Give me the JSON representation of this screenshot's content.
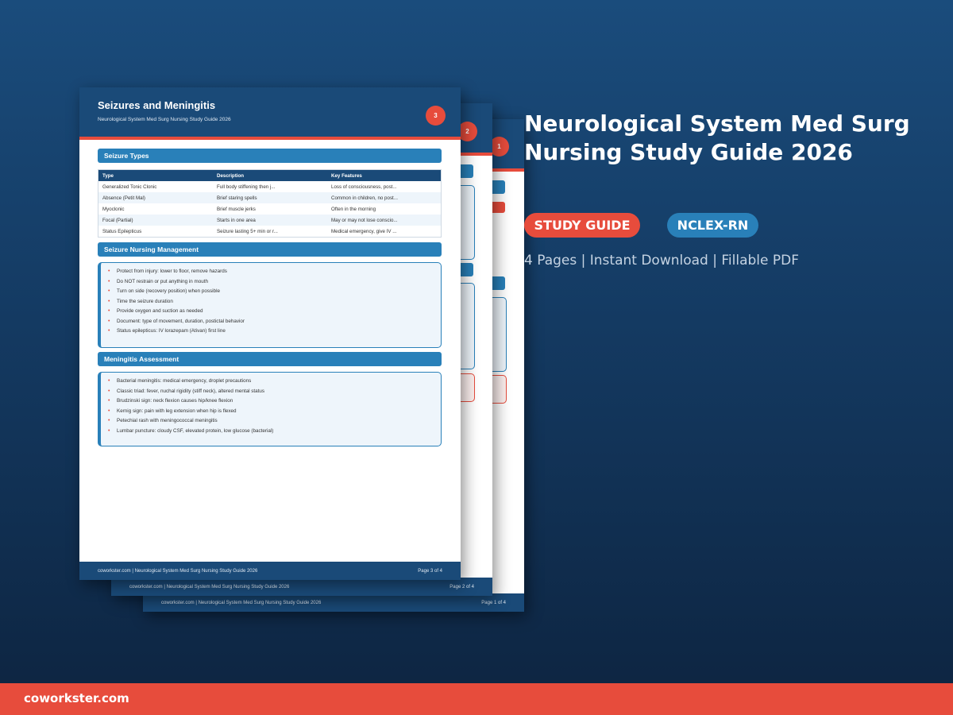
{
  "product": {
    "title": "Neurological System Med Surg Nursing Study Guide 2026",
    "badge_study": "STUDY GUIDE",
    "badge_exam": "NCLEX-RN",
    "meta": "4 Pages | Instant Download | Fillable PDF",
    "colors": {
      "accent": "#e74c3c",
      "primary": "#1a4a78",
      "secondary": "#2980b9"
    }
  },
  "brand": "coworkster.com",
  "pages": {
    "p1": {
      "number": "1",
      "footer_left": "coworkster.com | Neurological System Med Surg Nursing Study Guide 2026",
      "footer_right": "Page 1 of 4"
    },
    "p2": {
      "number": "2",
      "footer_left": "coworkster.com | Neurological System Med Surg Nursing Study Guide 2026",
      "footer_right": "Page 2 of 4"
    },
    "p3": {
      "number": "3",
      "title": "Seizures and Meningitis",
      "subtitle": "Neurological System Med Surg Nursing Study Guide 2026",
      "footer_left": "coworkster.com | Neurological System Med Surg Nursing Study Guide 2026",
      "footer_right": "Page 3 of 4",
      "sections": {
        "types_title": "Seizure Types",
        "table": {
          "headers": [
            "Type",
            "Description",
            "Key Features"
          ],
          "rows": [
            [
              "Generalized Tonic Clonic",
              "Full body stiffening then j...",
              "Loss of consciousness, post..."
            ],
            [
              "Absence (Petit Mal)",
              "Brief staring spells",
              "Common in children, no post..."
            ],
            [
              "Myoclonic",
              "Brief muscle jerks",
              "Often in the morning"
            ],
            [
              "Focal (Partial)",
              "Starts in one area",
              "May or may not lose conscio..."
            ],
            [
              "Status Epilepticus",
              "Seizure lasting 5+ min or r...",
              "Medical emergency, give IV ..."
            ]
          ]
        },
        "management_title": "Seizure Nursing Management",
        "management_items": [
          "Protect from injury: lower to floor, remove hazards",
          "Do NOT restrain or put anything in mouth",
          "Turn on side (recovery position) when possible",
          "Time the seizure duration",
          "Provide oxygen and suction as needed",
          "Document: type of movement, duration, postictal behavior",
          "Status epilepticus: IV lorazepam (Ativan) first line"
        ],
        "meningitis_title": "Meningitis Assessment",
        "meningitis_items": [
          "Bacterial meningitis: medical emergency, droplet precautions",
          "Classic triad: fever, nuchal rigidity (stiff neck), altered mental status",
          "Brudzinski sign: neck flexion causes hip/knee flexion",
          "Kernig sign: pain with leg extension when hip is flexed",
          "Petechial rash with meningococcal meningitis",
          "Lumbar puncture: cloudy CSF, elevated protein, low glucose (bacterial)"
        ]
      }
    }
  }
}
